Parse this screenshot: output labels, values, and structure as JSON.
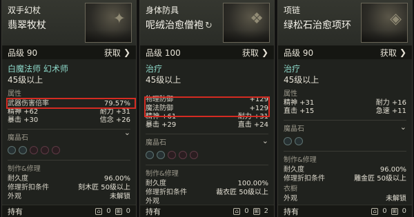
{
  "cards": [
    {
      "category": "双手幻杖",
      "name": "翡翠牧杖",
      "grade": "品级 90",
      "get_label": "获取",
      "classes": "白魔法师 幻术师",
      "level": "45级以上",
      "section_attr": "属性",
      "highlight": {
        "k1": "武器伤害倍率",
        "v1": "79.57%"
      },
      "stats": [
        {
          "l": "精神 +62",
          "r": "耐力 +31"
        },
        {
          "l": "暴击 +30",
          "r": "信念 +26"
        }
      ],
      "section_gems": "魔晶石",
      "section_craft": "制作&修理",
      "durability_label": "耐久度",
      "durability_value": "96.00%",
      "repair_label": "修理折扣条件",
      "repair_value": "刻木匠 50级以上",
      "tail_label": "外观",
      "tail_value": "未解锁",
      "footer_left": "持有",
      "footer_c1": "0",
      "footer_c2": "0"
    },
    {
      "category": "身体防具",
      "name": "呢绒治愈僧袍",
      "grade": "品级 100",
      "get_label": "获取",
      "classes": "治疗",
      "level": "45级以上",
      "section_attr": "",
      "highlight": {
        "k1": "物理防御",
        "v1": "+129",
        "k2": "魔法防御",
        "v2": "+129"
      },
      "stats": [
        {
          "l": "精神 +61",
          "r": "耐力 +31"
        },
        {
          "l": "暴击 +29",
          "r": "直击 +24"
        }
      ],
      "section_gems": "魔晶石",
      "section_craft": "制作&修理",
      "durability_label": "耐久度",
      "durability_value": "100.00%",
      "repair_label": "修理折扣条件",
      "repair_value": "裁衣匠 50级以上",
      "tail_label": "外观",
      "tail_value": "",
      "footer_left": "持有",
      "footer_c1": "0",
      "footer_c2": "2"
    },
    {
      "category": "项链",
      "name": "绿松石治愈项环",
      "grade": "品级 90",
      "get_label": "获取",
      "classes": "治疗",
      "level": "45级以上",
      "section_attr": "属性",
      "stats": [
        {
          "l": "精神 +31",
          "r": "耐力 +16"
        },
        {
          "l": "直击 +15",
          "r": "急速 +11"
        }
      ],
      "section_gems": "魔晶石",
      "section_craft": "制作&修理",
      "durability_label": "耐久度",
      "durability_value": "96.00%",
      "repair_label": "修理折扣条件",
      "repair_value": "雕金匠 50级以上",
      "extra_section": "衣橱",
      "tail_label": "外观",
      "tail_value": "未解锁",
      "footer_left": "持有",
      "footer_c1": "0",
      "footer_c2": "0"
    }
  ]
}
